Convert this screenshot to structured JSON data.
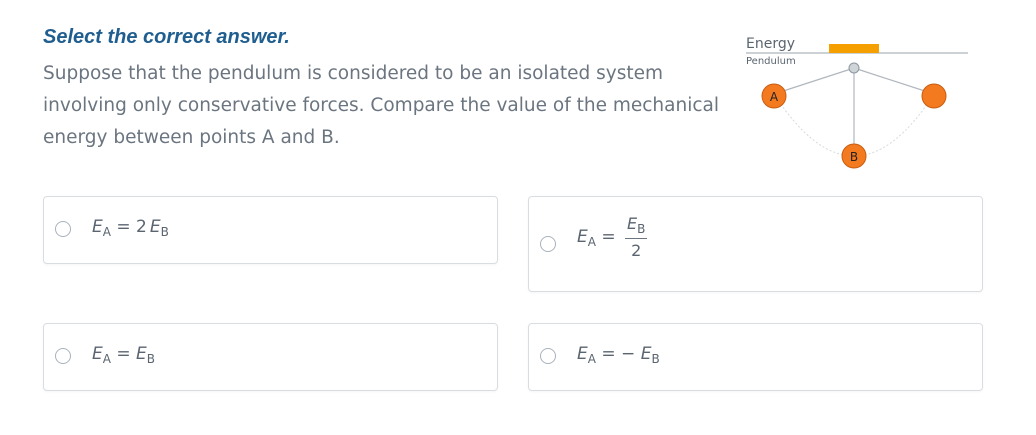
{
  "instruction": "Select the correct answer.",
  "question": "Suppose that the pendulum is considered to be an isolated system involving only conservative forces. Compare the value of the mechanical energy between points A and B.",
  "figure": {
    "title": "Energy",
    "subtitle": "Pendulum",
    "point_a": "A",
    "point_b": "B",
    "bar_color": "#f5a000",
    "bob_color": "#f47a20"
  },
  "options": [
    {
      "lhs": "E",
      "lhs_sub": "A",
      "rel": "=",
      "coef": "2",
      "rhs": "E",
      "rhs_sub": "B"
    },
    {
      "lhs": "E",
      "lhs_sub": "A",
      "rel": "=",
      "num": "E",
      "num_sub": "B",
      "den": "2"
    },
    {
      "lhs": "E",
      "lhs_sub": "A",
      "rel": "=",
      "rhs": "E",
      "rhs_sub": "B"
    },
    {
      "lhs": "E",
      "lhs_sub": "A",
      "rel": "=",
      "sign": "−",
      "rhs": "E",
      "rhs_sub": "B"
    }
  ]
}
